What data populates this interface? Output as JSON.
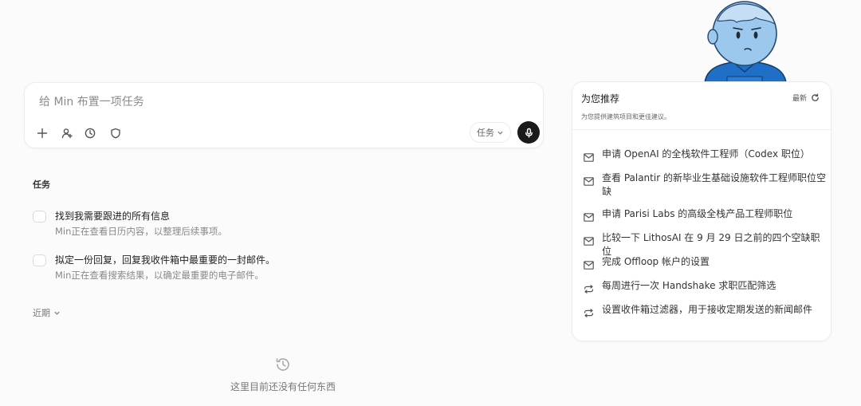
{
  "composer": {
    "placeholder": "给 Min 布置一项任务",
    "mode_label": "任务",
    "tools": [
      {
        "icon": "plus-icon"
      },
      {
        "icon": "add-person-icon"
      },
      {
        "icon": "clock-icon"
      },
      {
        "icon": "shield-icon"
      }
    ],
    "mic_icon": "microphone-icon"
  },
  "tasks": {
    "section_title": "任务",
    "items": [
      {
        "title": "找到我需要跟进的所有信息",
        "status": "Min正在查看日历内容，以整理后续事项。"
      },
      {
        "title": "拟定一份回复，回复我收件箱中最重要的一封邮件。",
        "status": "Min正在查看搜索结果，以确定最重要的电子邮件。"
      }
    ],
    "recent_label": "近期",
    "empty_text": "这里目前还没有任何东西"
  },
  "recommendations": {
    "title": "为您推荐",
    "subtitle": "为您提供建筑项目和更佳建议。",
    "refresh_label": "最新",
    "items": [
      {
        "icon": "mail-icon",
        "text": "申请 OpenAI 的全栈软件工程师（Codex 职位）"
      },
      {
        "icon": "mail-icon",
        "text": "查看 Palantir 的新毕业生基础设施软件工程师职位空缺"
      },
      {
        "icon": "mail-icon",
        "text": "申请 Parisi Labs 的高级全栈产品工程师职位"
      },
      {
        "icon": "mail-icon",
        "text": "比较一下 LithosAI 在 9 月 29 日之前的四个空缺职位"
      },
      {
        "icon": "mail-icon",
        "text": "完成 Offloop 帐户的设置"
      },
      {
        "icon": "repeat-icon",
        "text": "每周进行一次 Handshake 求职匹配筛选"
      },
      {
        "icon": "repeat-icon",
        "text": "设置收件箱过滤器，用于接收定期发送的新闻邮件"
      }
    ]
  },
  "colors": {
    "mascot_blue": "#9cc8ee",
    "mascot_shirt": "#1f6fc6",
    "mic_button": "#1a1a1a"
  }
}
